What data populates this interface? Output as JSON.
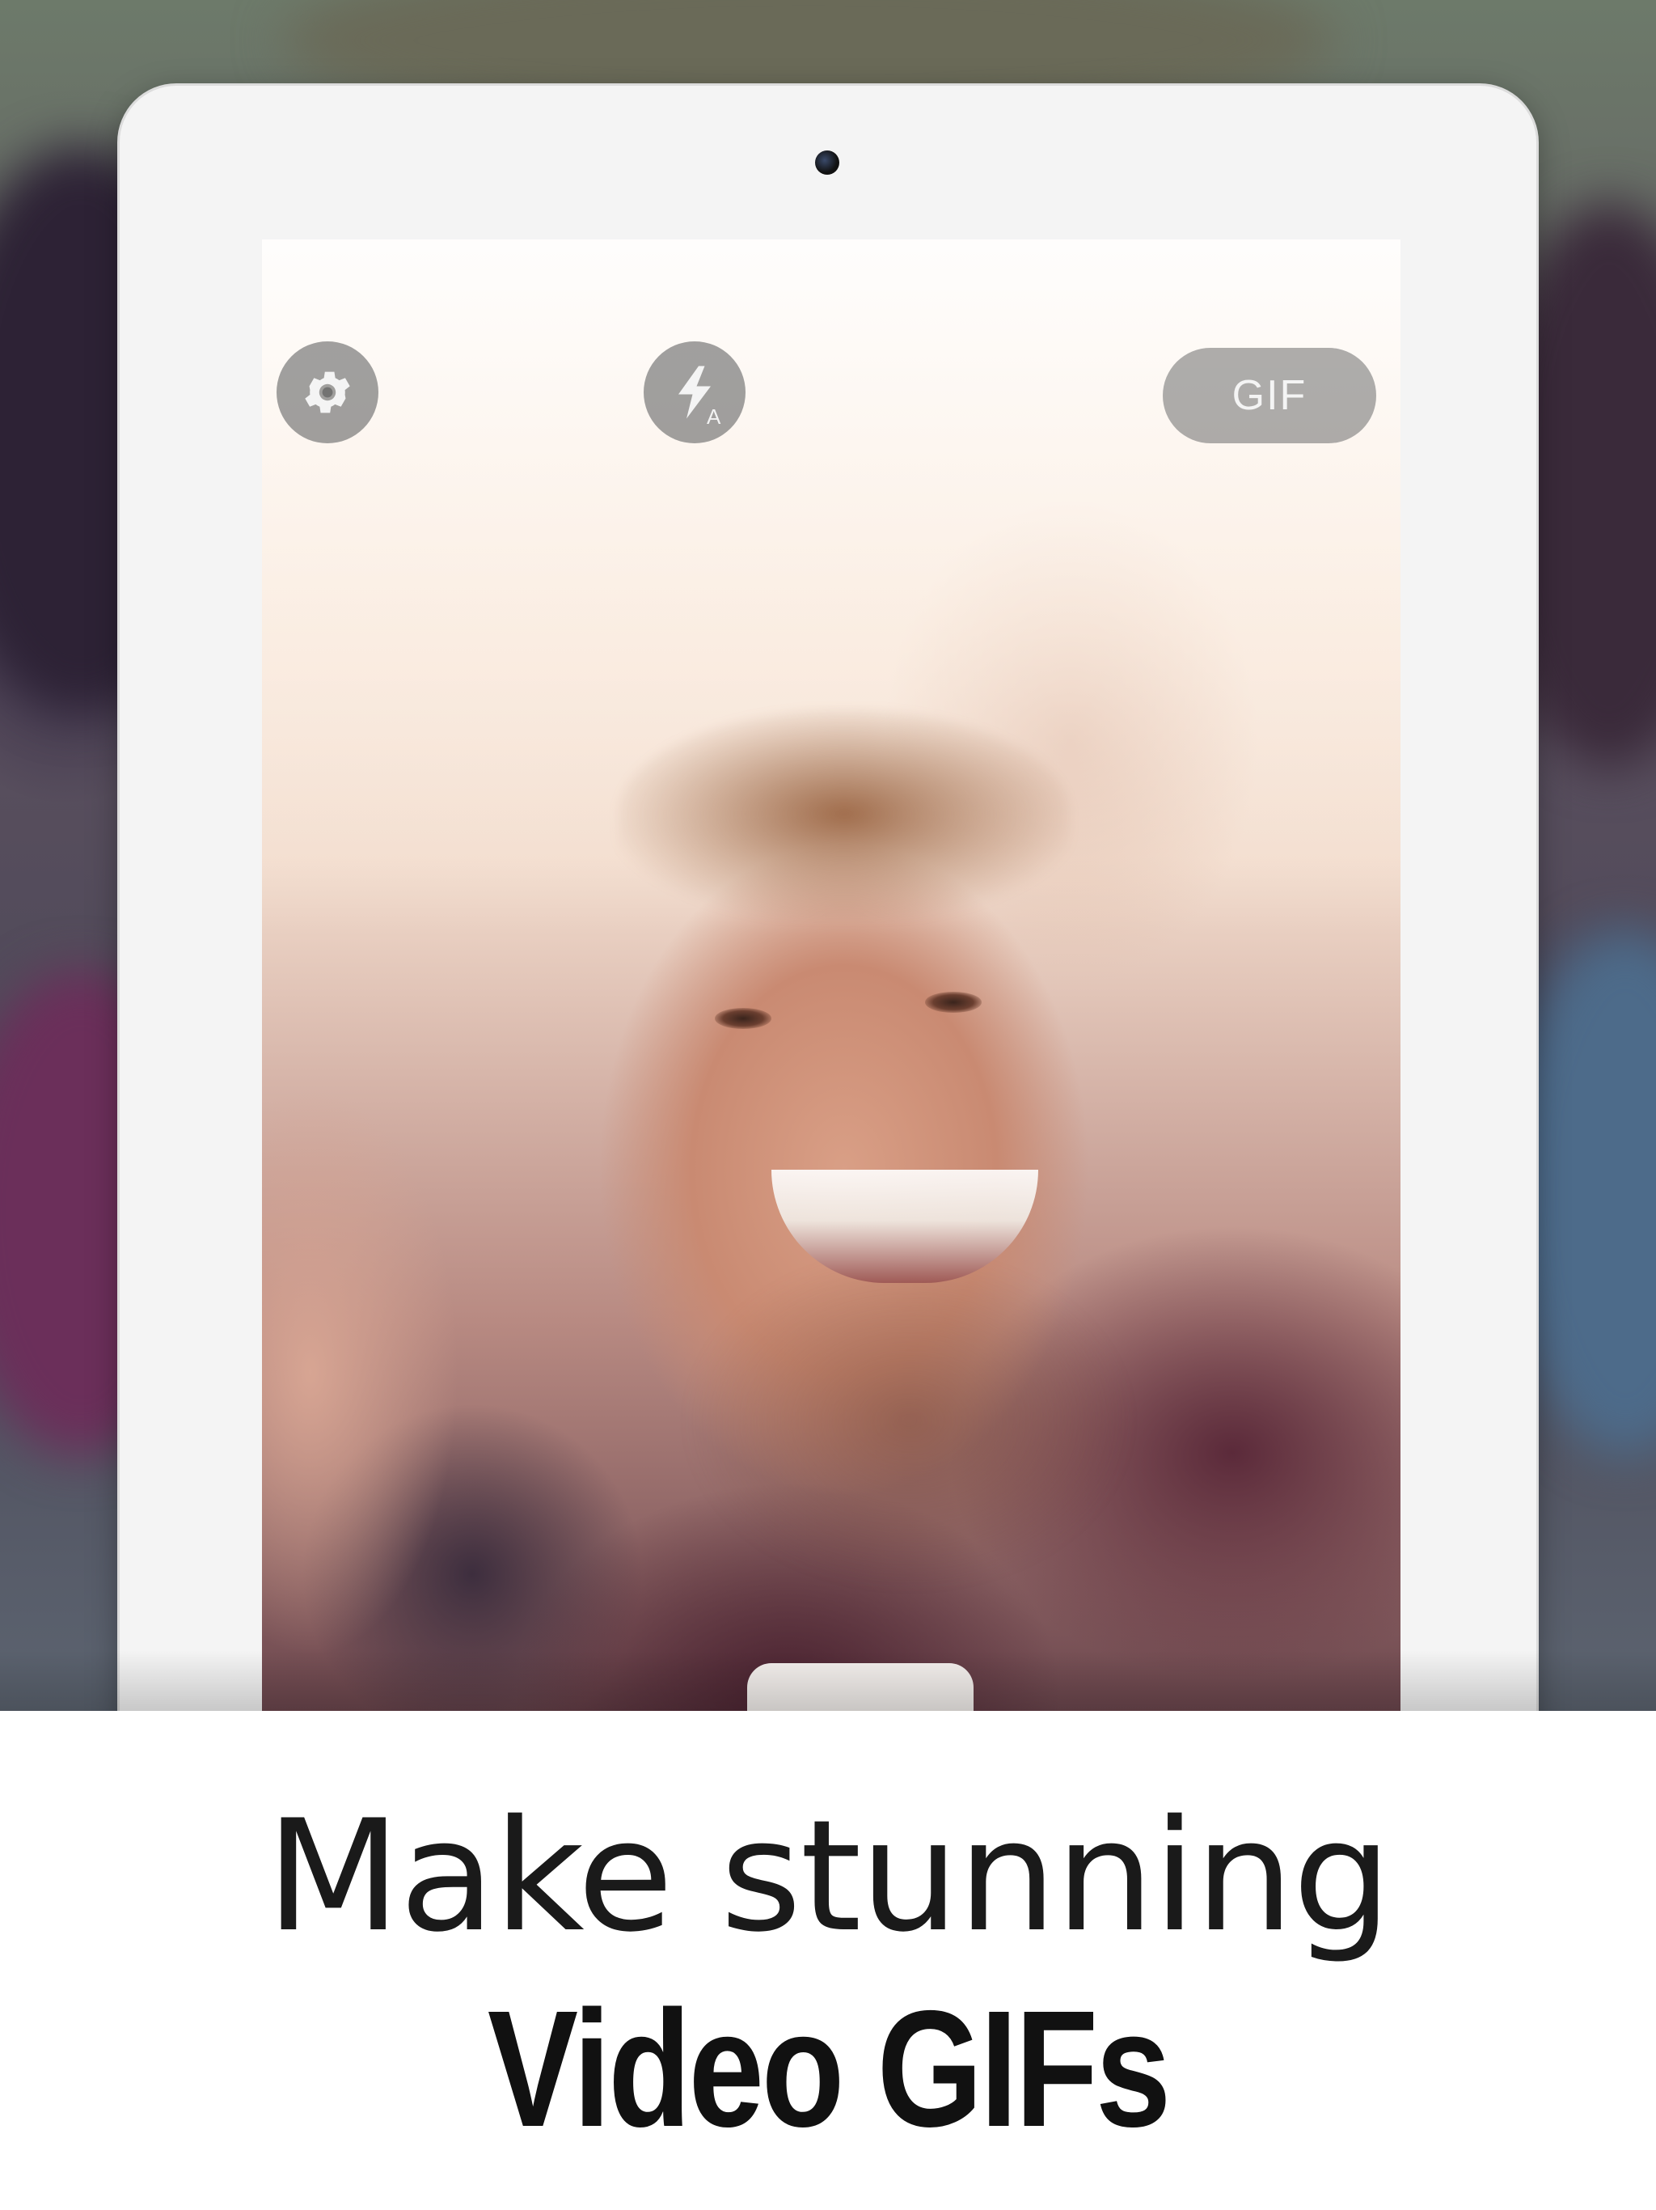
{
  "app": {
    "headline_line1": "Make stunning",
    "headline_line2": "Video GIFs"
  },
  "camera_controls": {
    "settings_icon": "gear-icon",
    "flash_icon": "flash-auto-icon",
    "flash_mode_label": "A",
    "gif_button_label": "GIF"
  },
  "colors": {
    "control_overlay": "#6e6e6e",
    "headline_text": "#111111",
    "tablet_bezel": "#f4f4f4"
  }
}
